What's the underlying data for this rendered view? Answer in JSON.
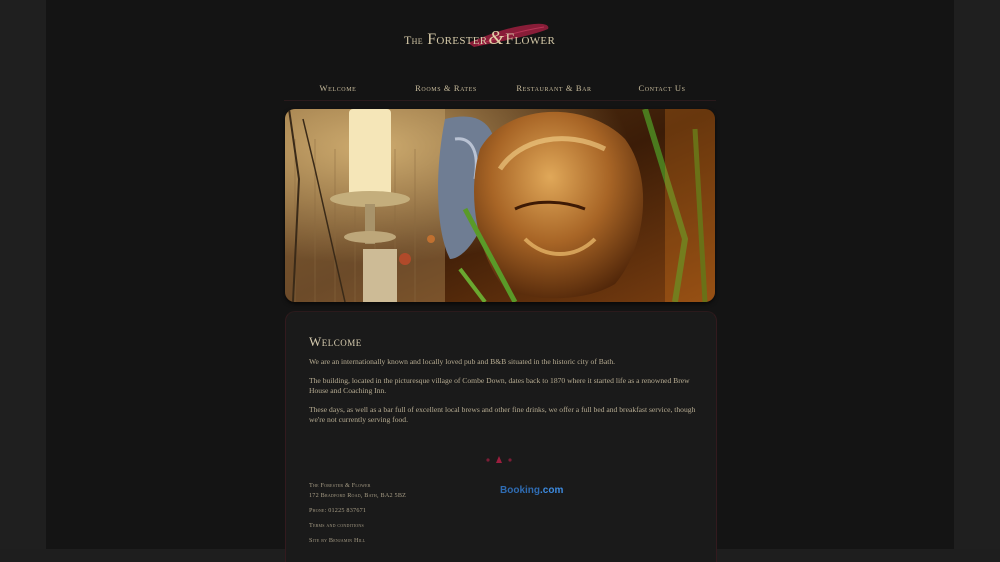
{
  "logo": {
    "the": "The",
    "forester": "Forester",
    "amp": "&",
    "flower": "Flower"
  },
  "nav": {
    "items": [
      "Welcome",
      "Rooms & Rates",
      "Restaurant & Bar",
      "Contact Us"
    ]
  },
  "colors": {
    "page_background": "#141414",
    "accent": "#9c1e3e",
    "text": "#b8ad93",
    "booking_blue": "#2f6cb3"
  },
  "main": {
    "title": "Welcome",
    "paragraphs": [
      "We are an internationally known and locally loved pub and B&B situated in the historic city of Bath.",
      "The building, located in the picturesque village of Combe Down, dates back to 1870 where it started life as a renowned Brew House and Coaching Inn.",
      "These days, as well as a bar full of excellent local brews and other fine drinks, we offer a full bed and breakfast service, though we're not currently serving food."
    ]
  },
  "footer": {
    "name": "The Forester & Flower",
    "address": "172 Bradford Road, Bath, BA2 5BZ",
    "phone": "Phone: 01225 837671",
    "terms": "Terms and conditions",
    "credit": "Site by Benjamin Hill",
    "booking_brand": "Booking",
    "booking_tld": ".com"
  }
}
